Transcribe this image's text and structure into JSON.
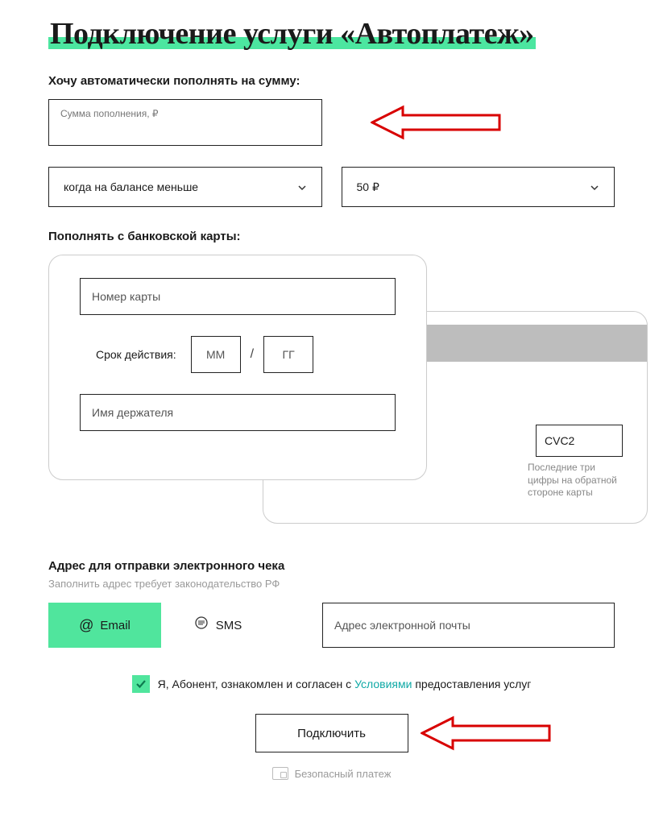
{
  "title": "Подключение услуги «Автоплатеж»",
  "amount_section": {
    "label": "Хочу автоматически пополнять на сумму:",
    "placeholder": "Сумма пополнения, ₽"
  },
  "condition_select": {
    "value": "когда на балансе меньше"
  },
  "threshold_select": {
    "value": "50 ₽"
  },
  "card_section": {
    "label": "Пополнять с банковской карты:",
    "number_placeholder": "Номер карты",
    "expiry_label": "Срок действия:",
    "mm": "ММ",
    "yy": "ГГ",
    "holder_placeholder": "Имя держателя",
    "cvc_placeholder": "CVC2",
    "cvc_hint": "Последние три цифры на обратной стороне карты"
  },
  "receipt": {
    "title": "Адрес для отправки электронного чека",
    "subtitle": "Заполнить адрес требует законодательство РФ",
    "tab_email": "Email",
    "tab_sms": "SMS",
    "email_placeholder": "Адрес электронной почты"
  },
  "agreement": {
    "prefix": "Я, Абонент, ознакомлен и согласен с ",
    "link": "Условиями",
    "suffix": " предоставления услуг"
  },
  "submit": "Подключить",
  "secure": "Безопасный платеж"
}
